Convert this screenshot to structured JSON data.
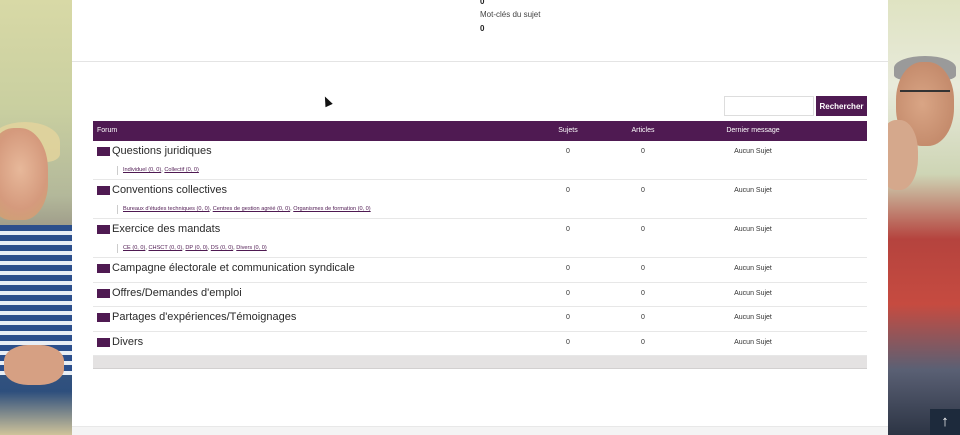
{
  "top_stats": {
    "value_top": "0",
    "keywords_label": "Mot-clés du sujet",
    "keywords_value": "0"
  },
  "search": {
    "placeholder": "",
    "button_label": "Rechercher"
  },
  "table": {
    "headers": {
      "forum": "Forum",
      "sujets": "Sujets",
      "articles": "Articles",
      "last": "Dernier message"
    },
    "rows": [
      {
        "title": "Questions juridiques",
        "sujets": "0",
        "articles": "0",
        "last": "Aucun Sujet",
        "subs": [
          {
            "label": "Individuel (0, 0)"
          },
          {
            "label": "Collectif (0, 0)"
          }
        ]
      },
      {
        "title": "Conventions collectives",
        "sujets": "0",
        "articles": "0",
        "last": "Aucun Sujet",
        "subs": [
          {
            "label": "Bureaux d'études techniques (0, 0)"
          },
          {
            "label": "Centres de gestion agréé (0, 0)"
          },
          {
            "label": "Organismes de formation (0, 0)"
          }
        ]
      },
      {
        "title": "Exercice des mandats",
        "sujets": "0",
        "articles": "0",
        "last": "Aucun Sujet",
        "subs": [
          {
            "label": "CE (0, 0)"
          },
          {
            "label": "CHSCT (0, 0)"
          },
          {
            "label": "DP (0, 0)"
          },
          {
            "label": "DS (0, 0)"
          },
          {
            "label": "Divers (0, 0)"
          }
        ]
      },
      {
        "title": "Campagne électorale et communication syndicale",
        "sujets": "0",
        "articles": "0",
        "last": "Aucun Sujet",
        "subs": []
      },
      {
        "title": "Offres/Demandes d'emploi",
        "sujets": "0",
        "articles": "0",
        "last": "Aucun Sujet",
        "subs": []
      },
      {
        "title": "Partages d'expériences/Témoignages",
        "sujets": "0",
        "articles": "0",
        "last": "Aucun Sujet",
        "subs": []
      },
      {
        "title": "Divers",
        "sujets": "0",
        "articles": "0",
        "last": "Aucun Sujet",
        "subs": []
      }
    ]
  },
  "scroll_top": {
    "glyph": "↑"
  },
  "colors": {
    "accent": "#4f1a52",
    "footer_bar": "#e4e2e2"
  },
  "icons": {
    "forum_row": "envelope-icon",
    "scroll_top": "arrow-up-icon"
  }
}
